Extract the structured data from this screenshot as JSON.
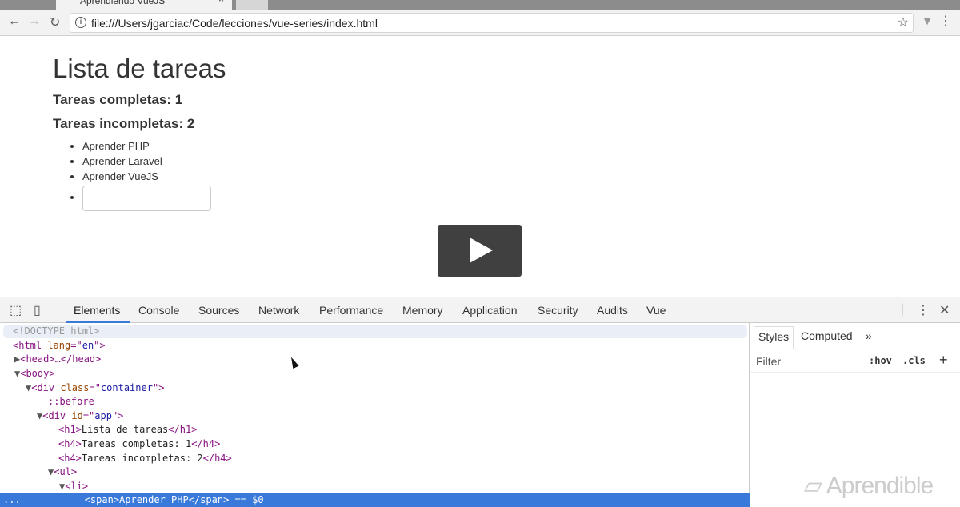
{
  "browser": {
    "tab_title": "Aprendiendo VueJS",
    "url": "file:///Users/jgarciac/Code/lecciones/vue-series/index.html"
  },
  "page": {
    "title": "Lista de tareas",
    "completed": "Tareas completas: 1",
    "incomplete": "Tareas incompletas: 2",
    "tasks": [
      "Aprender PHP",
      "Aprender Laravel",
      "Aprender VueJS"
    ],
    "new_task_value": ""
  },
  "devtools": {
    "tabs": [
      "Elements",
      "Console",
      "Sources",
      "Network",
      "Performance",
      "Memory",
      "Application",
      "Security",
      "Audits",
      "Vue"
    ],
    "dom": [
      {
        "t": "<!DOCTYPE html>"
      },
      {
        "a": "<html ",
        "b": "lang",
        "c": "=\"",
        "d": "en",
        "e": "\">"
      },
      {
        "t": "<head>…</head>"
      },
      {
        "t": "<body>"
      },
      {
        "a": "<div ",
        "b": "class",
        "c": "=\"",
        "d": "container",
        "e": "\">"
      },
      {
        "t": "::before"
      },
      {
        "a": "<div ",
        "b": "id",
        "c": "=\"",
        "d": "app",
        "e": "\">"
      },
      {
        "o": "<h1>",
        "x": "Lista de tareas",
        "cl": "</h1>"
      },
      {
        "o": "<h4>",
        "x": "Tareas completas: 1",
        "cl": "</h4>"
      },
      {
        "o": "<h4>",
        "x": "Tareas incompletas: 2",
        "cl": "</h4>"
      },
      {
        "t": "<ul>"
      },
      {
        "t": "<li>"
      },
      {
        "t": "<span>Aprender PHP</span> == $0"
      }
    ],
    "sidebar": {
      "tabs": [
        "Styles",
        "Computed",
        "»"
      ],
      "filter": "Filter",
      "hov": ":hov",
      "cls": ".cls",
      "add": "+"
    }
  },
  "watermark": "Aprendible"
}
